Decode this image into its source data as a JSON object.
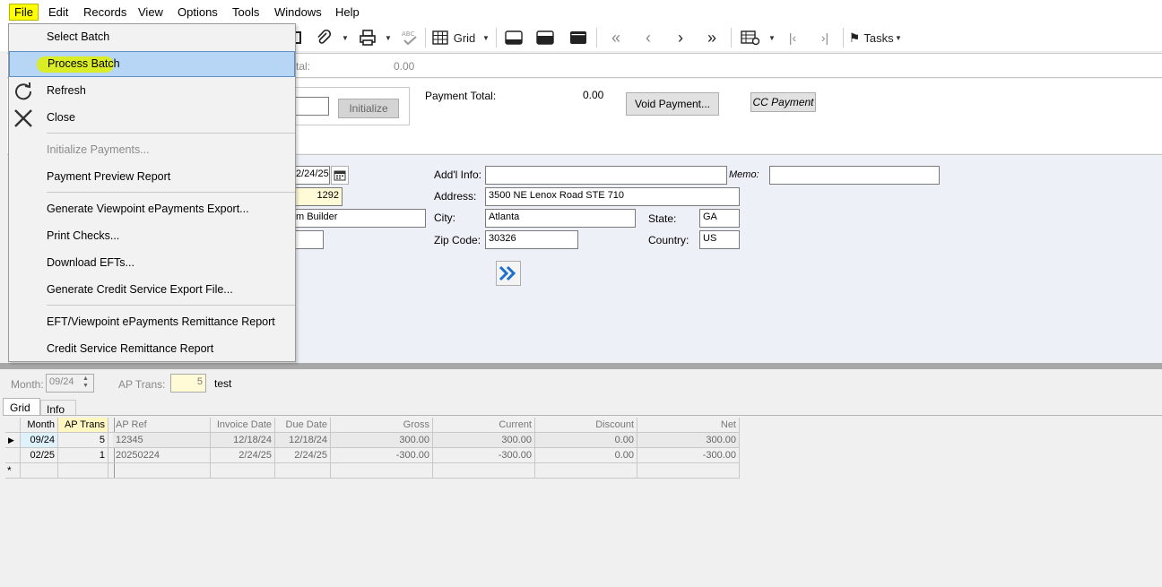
{
  "menubar": {
    "items": [
      "File",
      "Edit",
      "Records",
      "View",
      "Options",
      "Tools",
      "Windows",
      "Help"
    ]
  },
  "toolbar": {
    "grid_label": "Grid",
    "tasks_label": "Tasks"
  },
  "file_menu": {
    "items": [
      {
        "label": "Select Batch",
        "enabled": true
      },
      {
        "label": "Process Batch",
        "enabled": true,
        "highlighted": true
      },
      {
        "label": "Refresh",
        "enabled": true,
        "icon": "refresh-icon"
      },
      {
        "label": "Close",
        "enabled": true,
        "icon": "close-icon"
      },
      {
        "label": "Initialize Payments...",
        "enabled": false
      },
      {
        "label": "Payment Preview Report",
        "enabled": true
      },
      {
        "label": "Generate Viewpoint ePayments Export...",
        "enabled": true
      },
      {
        "label": "Print Checks...",
        "enabled": true
      },
      {
        "label": "Download EFTs...",
        "enabled": true
      },
      {
        "label": "Generate Credit Service Export File...",
        "enabled": true
      },
      {
        "label": "EFT/Viewpoint ePayments Remittance Report",
        "enabled": true
      },
      {
        "label": "Credit Service Remittance Report",
        "enabled": true
      }
    ]
  },
  "header": {
    "total_label_partial": "tal:",
    "total_value": "0.00",
    "initialize_button": "Initialize",
    "payment_total_label": "Payment Total:",
    "payment_total_value": "0.00",
    "void_payment_button": "Void Payment...",
    "cc_payment_button": "CC Payment"
  },
  "detail": {
    "date_value": "2/24/25",
    "number_value": "1292",
    "name_value_partial": "m Builder",
    "addl_info_label": "Add'l Info:",
    "addl_info_value": "",
    "memo_label": "Memo:",
    "memo_value": "",
    "address_label": "Address:",
    "address_value": "3500 NE Lenox Road STE 710",
    "city_label": "City:",
    "city_value": "Atlanta",
    "state_label": "State:",
    "state_value": "GA",
    "zip_label": "Zip Code:",
    "zip_value": "30326",
    "country_label": "Country:",
    "country_value": "US"
  },
  "lower": {
    "month_label": "Month:",
    "month_value": "09/24",
    "ap_trans_label": "AP Trans:",
    "ap_trans_value": "5",
    "description": "test",
    "tabs": [
      "Grid",
      "Info"
    ]
  },
  "grid": {
    "columns": [
      "Month",
      "AP Trans",
      "AP Ref",
      "Invoice Date",
      "Due Date",
      "Gross",
      "Current",
      "Discount",
      "Net"
    ],
    "rows": [
      [
        "09/24",
        "5",
        "12345",
        "12/18/24",
        "12/18/24",
        "300.00",
        "300.00",
        "0.00",
        "300.00"
      ],
      [
        "02/25",
        "1",
        "20250224",
        "2/24/25",
        "2/24/25",
        "-300.00",
        "-300.00",
        "0.00",
        "-300.00"
      ]
    ]
  },
  "colors": {
    "file_highlight": "#ffff00",
    "menu_selected": "#b7d6f5",
    "marker_highlight": "#e0f000",
    "required_field": "#fffbd6"
  }
}
